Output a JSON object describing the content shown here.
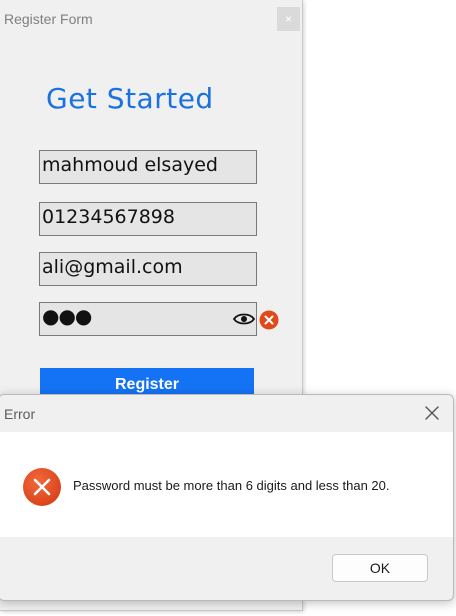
{
  "register_window": {
    "title": "Register Form",
    "close_glyph": "×",
    "heading": "Get Started",
    "name_value": "mahmoud elsayed",
    "phone_value": "01234567898",
    "email_value": "ali@gmail.com",
    "password_masked": "●●●",
    "register_label": "Register",
    "icons": [
      "eye-icon",
      "error-icon"
    ]
  },
  "error_dialog": {
    "title": "Error",
    "message": "Password must be more than 6 digits and less than 20.",
    "ok_label": "OK",
    "icons": [
      "close-icon",
      "error-icon"
    ]
  },
  "colors": {
    "heading": "#1a72e0",
    "register_button": "#1473f5",
    "error_icon": "#e04a1a",
    "window_bg": "#f0f0f0"
  }
}
